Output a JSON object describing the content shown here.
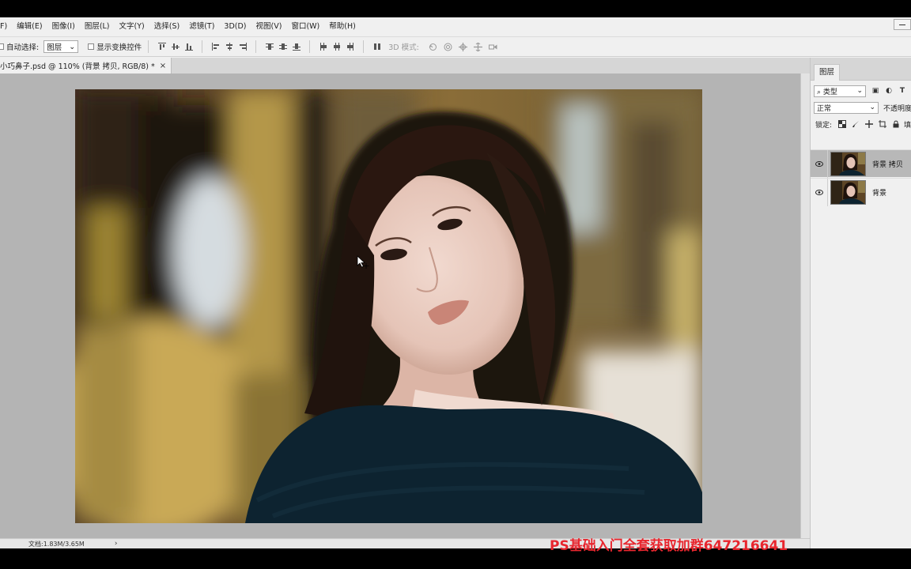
{
  "menubar": {
    "items": [
      "F)",
      "编辑(E)",
      "图像(I)",
      "图层(L)",
      "文字(Y)",
      "选择(S)",
      "滤镜(T)",
      "3D(D)",
      "视图(V)",
      "窗口(W)",
      "帮助(H)"
    ]
  },
  "options_bar": {
    "auto_select_label": "自动选择:",
    "auto_select_value": "图层",
    "show_transform_label": "显示变换控件",
    "mode_3d_label": "3D 模式:"
  },
  "document": {
    "tab_title": "小巧鼻子.psd @ 110% (背景 拷贝, RGB/8) *",
    "close_glyph": "×"
  },
  "status": {
    "doc_size": "文档:1.83M/3.65M",
    "arrow": "›"
  },
  "layers_panel": {
    "tab_label": "图层",
    "filter_value": "类型",
    "blend_mode": "正常",
    "opacity_label": "不透明度",
    "lock_label": "锁定:",
    "fill_label": "填充",
    "layers": [
      {
        "name": "背景 拷贝",
        "selected": true,
        "visible": true
      },
      {
        "name": "背景",
        "selected": false,
        "visible": true
      }
    ],
    "bottom_icons": [
      "link-icon",
      "fx-icon",
      "mask-icon",
      "adjustment-icon",
      "folder-icon"
    ]
  },
  "watermark": {
    "text": "PS基础入门全套获取加群647216641",
    "color": "#e8262e"
  }
}
